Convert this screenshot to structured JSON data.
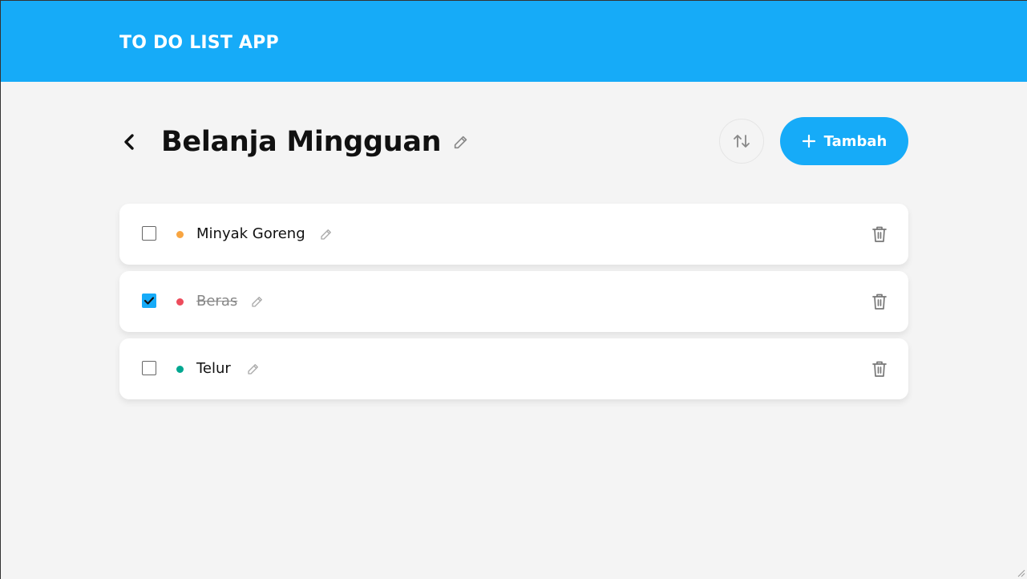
{
  "header": {
    "title": "TO DO LIST APP"
  },
  "page": {
    "title": "Belanja Mingguan",
    "back_icon": "chevron-left-icon",
    "edit_icon": "pencil-icon"
  },
  "toolbar": {
    "sort_icon": "sort-arrows-icon",
    "add_label": "Tambah",
    "add_icon": "plus-icon"
  },
  "items": [
    {
      "label": "Minyak Goreng",
      "checked": false,
      "priority_color": "#f8a541"
    },
    {
      "label": "Beras",
      "checked": true,
      "priority_color": "#ed4c5c"
    },
    {
      "label": "Telur",
      "checked": false,
      "priority_color": "#00a790"
    }
  ],
  "colors": {
    "primary": "#16abf8",
    "background": "#f4f4f4"
  }
}
